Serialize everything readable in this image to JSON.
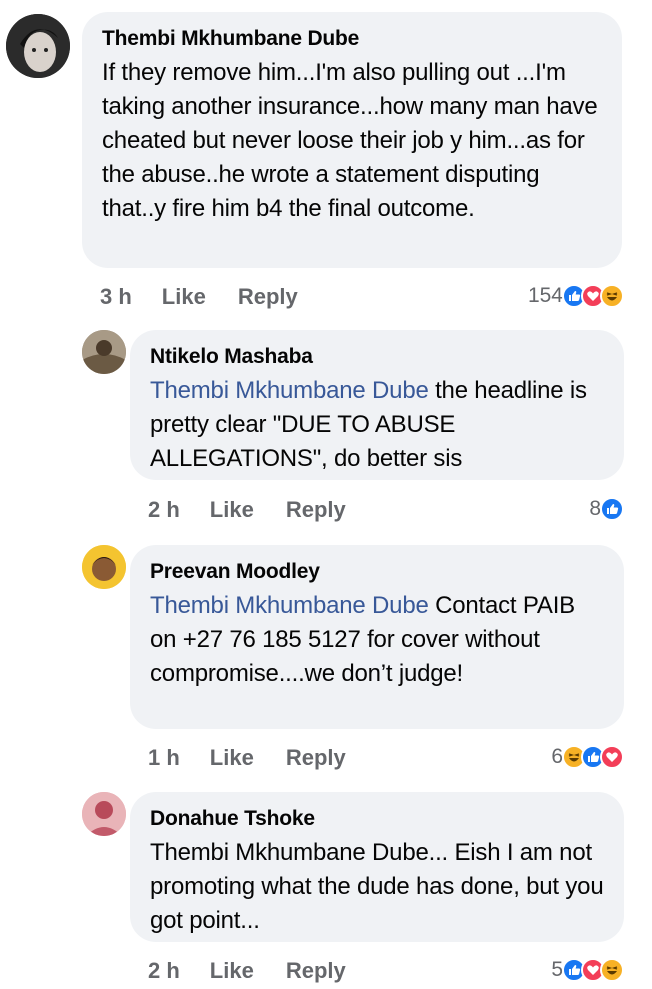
{
  "comments": [
    {
      "author": "Thembi Mkhumbane Dube",
      "mention": "",
      "text": "If they remove him...I'm also pulling out ...I'm taking another insurance...how many man have cheated but never loose their job y him...as for the abuse..he wrote a statement disputing that..y fire him b4 the final outcome.",
      "time": "3 h",
      "like_label": "Like",
      "reply_label": "Reply",
      "reaction_count": "154",
      "reactions": [
        "like-icon",
        "love-icon",
        "haha-icon"
      ]
    },
    {
      "author": "Ntikelo Mashaba",
      "mention": "Thembi Mkhumbane Dube",
      "text": " the headline is pretty clear \"DUE TO ABUSE ALLEGATIONS\", do better sis",
      "time": "2 h",
      "like_label": "Like",
      "reply_label": "Reply",
      "reaction_count": "8",
      "reactions": [
        "like-icon"
      ]
    },
    {
      "author": "Preevan Moodley",
      "mention": "Thembi Mkhumbane Dube",
      "text": " Contact PAIB on +27 76 185 5127 for cover without compromise....we don’t judge!",
      "time": "1 h",
      "like_label": "Like",
      "reply_label": "Reply",
      "reaction_count": "6",
      "reactions": [
        "haha-icon",
        "like-icon",
        "love-icon"
      ]
    },
    {
      "author": "Donahue Tshoke",
      "mention": "",
      "text": "Thembi Mkhumbane Dube... Eish I am not promoting what the dude has done,  but you got point...",
      "time": "2 h",
      "like_label": "Like",
      "reply_label": "Reply",
      "reaction_count": "5",
      "reactions": [
        "like-icon",
        "love-icon",
        "haha-icon"
      ]
    }
  ],
  "colors": {
    "bubble": "#f0f2f5",
    "mention": "#385898",
    "like": "#1877f2",
    "love": "#f33e58",
    "haha": "#f7b125",
    "meta": "#65676b"
  }
}
